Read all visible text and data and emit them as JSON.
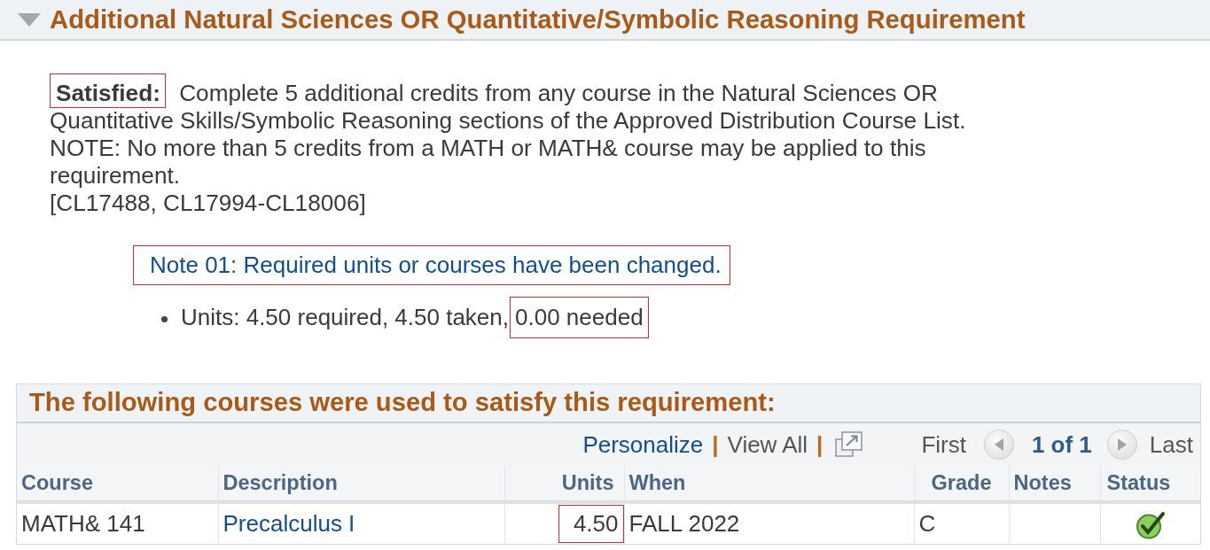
{
  "section": {
    "title": "Additional Natural Sciences OR Quantitative/Symbolic Reasoning Requirement",
    "expanded": true
  },
  "requirement": {
    "status": {
      "text": "Satisfied:",
      "highlighted": true
    },
    "description": [
      "Complete 5 additional credits from any course in the Natural Sciences OR Quantitative Skills/Symbolic Reasoning sections of the Approved Distribution Course List.",
      "NOTE: No more than 5 credits from a MATH or MATH& course may be applied to this requirement.",
      "[CL17488, CL17994-CL18006]"
    ]
  },
  "note": {
    "text": "Note 01: Required units or courses have been changed.",
    "highlighted": true
  },
  "units": [
    {
      "text": "Units: 4.50 required, 4.50 taken,",
      "highlighted": false
    },
    {
      "text": "0.00 needed",
      "highlighted": true
    }
  ],
  "grid": {
    "title": "The following courses were used to satisfy this requirement:",
    "toolbar": [
      {
        "kind": "link",
        "text": "Personalize",
        "disabled": false
      },
      {
        "kind": "separator",
        "text": "|"
      },
      {
        "kind": "link",
        "text": "View All",
        "disabled": true
      },
      {
        "kind": "separator",
        "text": "|"
      },
      {
        "kind": "popout"
      }
    ],
    "pager": {
      "first": {
        "text": "First",
        "disabled": true
      },
      "previous": {
        "disabled": true
      },
      "position": "1 of 1",
      "next": {
        "disabled": true
      },
      "last": {
        "text": "Last",
        "disabled": true
      }
    },
    "columns": [
      "Course",
      "Description",
      "Units",
      "When",
      "Grade",
      "Notes",
      "Status"
    ],
    "rows": [
      {
        "cells": [
          {
            "kind": "text",
            "text": "MATH& 141"
          },
          {
            "kind": "link",
            "text": "Precalculus I"
          },
          {
            "kind": "number",
            "text": "4.50",
            "highlighted": true
          },
          {
            "kind": "text",
            "text": "FALL 2022"
          },
          {
            "kind": "text",
            "text": "C"
          },
          {
            "kind": "blank"
          },
          {
            "kind": "status",
            "complete": true
          }
        ]
      }
    ]
  }
}
